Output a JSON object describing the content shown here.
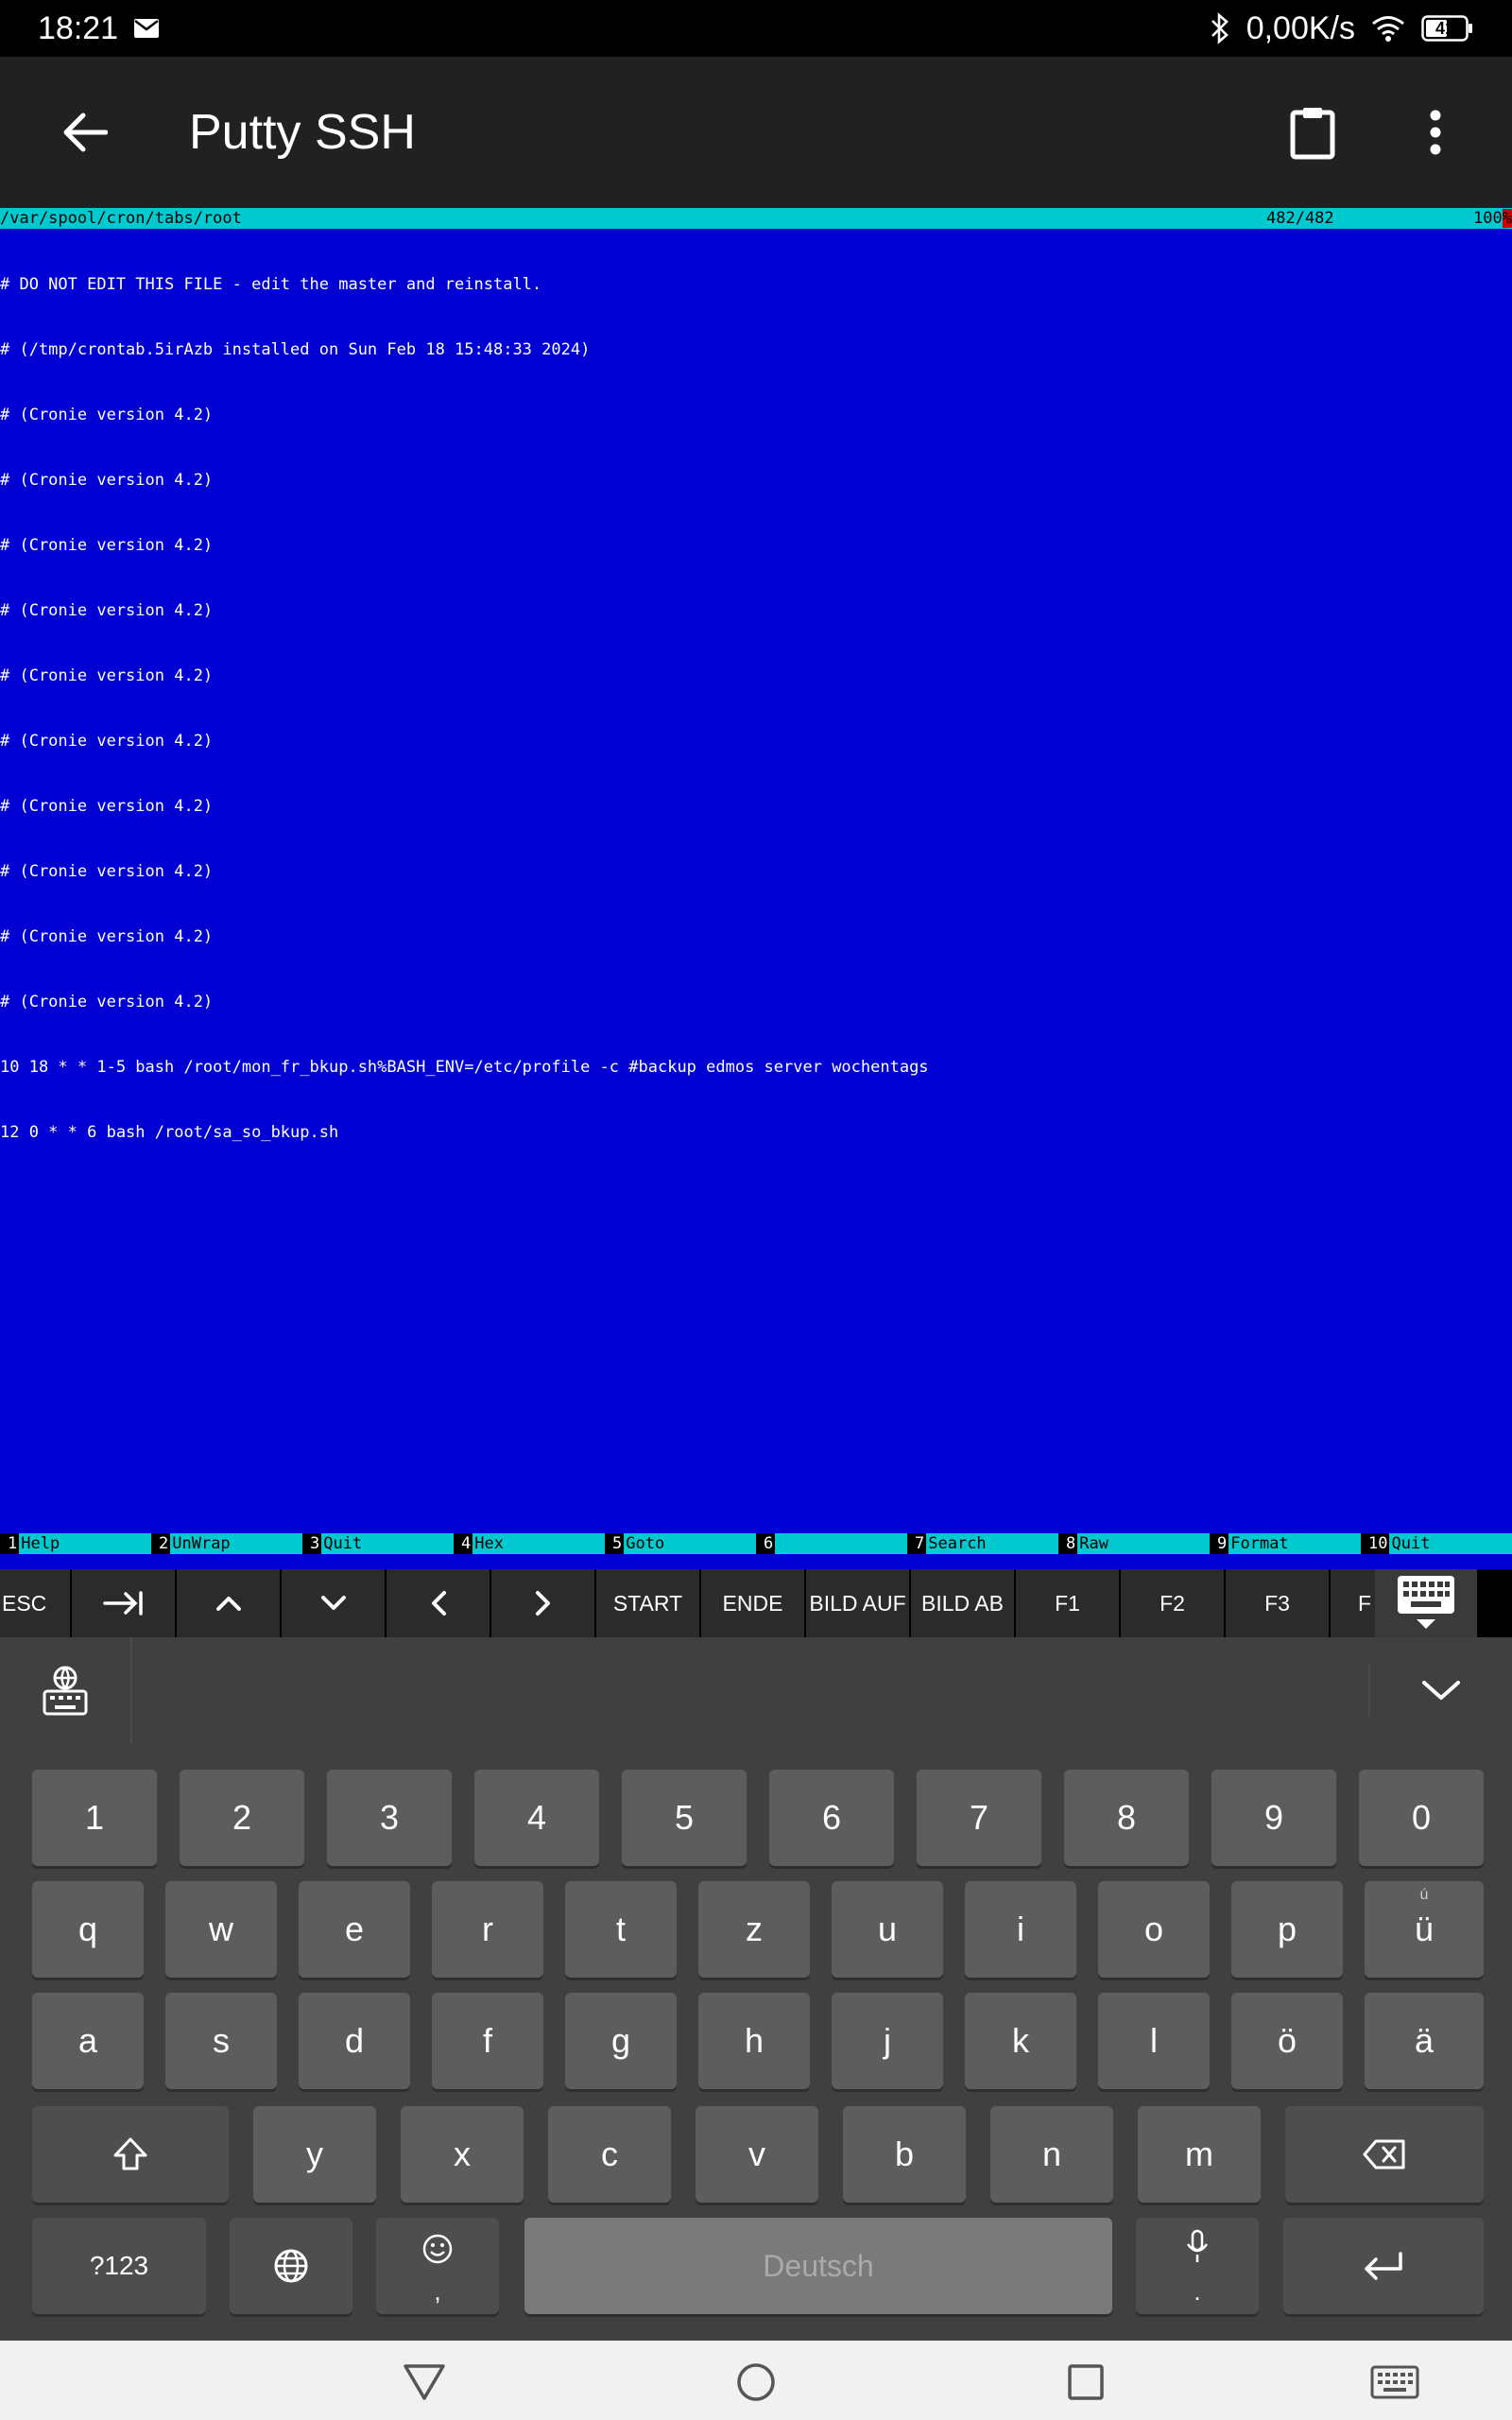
{
  "status_bar": {
    "time": "18:21",
    "mail_icon": "mail-icon",
    "net_speed": "0,00K/s",
    "battery": "41"
  },
  "app_bar": {
    "title": "Putty SSH"
  },
  "terminal": {
    "header_path": "/var/spool/cron/tabs/root",
    "header_position": "482/482",
    "header_percent": "100",
    "header_percent_mark": "%",
    "lines": [
      "# DO NOT EDIT THIS FILE - edit the master and reinstall.",
      "# (/tmp/crontab.5irAzb installed on Sun Feb 18 15:48:33 2024)",
      "# (Cronie version 4.2)",
      "# (Cronie version 4.2)",
      "# (Cronie version 4.2)",
      "# (Cronie version 4.2)",
      "# (Cronie version 4.2)",
      "# (Cronie version 4.2)",
      "# (Cronie version 4.2)",
      "# (Cronie version 4.2)",
      "# (Cronie version 4.2)",
      "# (Cronie version 4.2)",
      "10 18 * * 1-5 bash /root/mon_fr_bkup.sh%BASH_ENV=/etc/profile -c #backup edmos server wochentags",
      "12 0 * * 6 bash /root/sa_so_bkup.sh"
    ],
    "function_keys": [
      {
        "num": "1",
        "label": "Help"
      },
      {
        "num": "2",
        "label": "UnWrap"
      },
      {
        "num": "3",
        "label": "Quit"
      },
      {
        "num": "4",
        "label": "Hex"
      },
      {
        "num": "5",
        "label": "Goto"
      },
      {
        "num": "6",
        "label": ""
      },
      {
        "num": "7",
        "label": "Search"
      },
      {
        "num": "8",
        "label": "Raw"
      },
      {
        "num": "9",
        "label": "Format"
      },
      {
        "num": "10",
        "label": "Quit"
      }
    ]
  },
  "extra_keys": {
    "esc": "ESC",
    "start": "START",
    "ende": "ENDE",
    "bild_auf": "BILD AUF",
    "bild_ab": "BILD AB",
    "f1": "F1",
    "f2": "F2",
    "f3": "F3",
    "f4_partial": "F"
  },
  "keyboard": {
    "number_row": [
      "1",
      "2",
      "3",
      "4",
      "5",
      "6",
      "7",
      "8",
      "9",
      "0"
    ],
    "row1": [
      "q",
      "w",
      "e",
      "r",
      "t",
      "z",
      "u",
      "i",
      "o",
      "p",
      "ü"
    ],
    "row1_hint_u": "ú",
    "row2": [
      "a",
      "s",
      "d",
      "f",
      "g",
      "h",
      "j",
      "k",
      "l",
      "ö",
      "ä"
    ],
    "row3": [
      "y",
      "x",
      "c",
      "v",
      "b",
      "n",
      "m"
    ],
    "symbols_key": "?123",
    "comma_key": ",",
    "space_label": "Deutsch",
    "period_key": "."
  },
  "colors": {
    "terminal_bg": "#0000D3",
    "terminal_bar": "#00C9CF",
    "app_bar_bg": "#212121"
  }
}
